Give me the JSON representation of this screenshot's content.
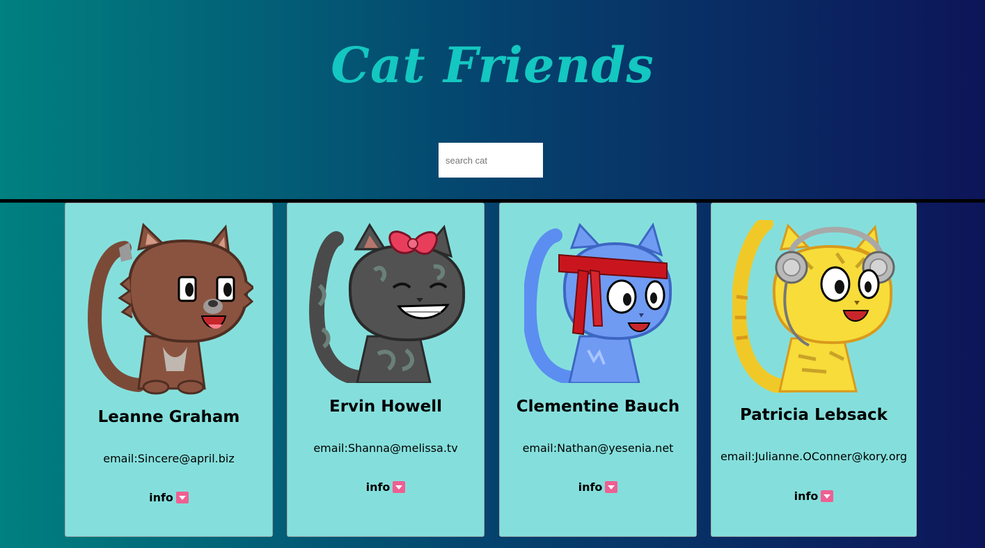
{
  "header": {
    "title": "Cat Friends"
  },
  "search": {
    "placeholder": "search cat"
  },
  "colors": {
    "title": "#14c7c0",
    "card": "#84dfdc",
    "info_icon": "#ee5f92"
  },
  "cards": [
    {
      "name": "Leanne Graham",
      "email": "email:Sincere@april.biz",
      "info_label": "info",
      "icon": "cat-brown-icon"
    },
    {
      "name": "Ervin Howell",
      "email": "email:Shanna@melissa.tv",
      "info_label": "info",
      "icon": "cat-grey-bow-icon"
    },
    {
      "name": "Clementine Bauch",
      "email": "email:Nathan@yesenia.net",
      "info_label": "info",
      "icon": "cat-blue-headband-icon"
    },
    {
      "name": "Patricia Lebsack",
      "email": "email:Julianne.OConner@kory.org",
      "info_label": "info",
      "icon": "cat-yellow-headphones-icon"
    }
  ]
}
